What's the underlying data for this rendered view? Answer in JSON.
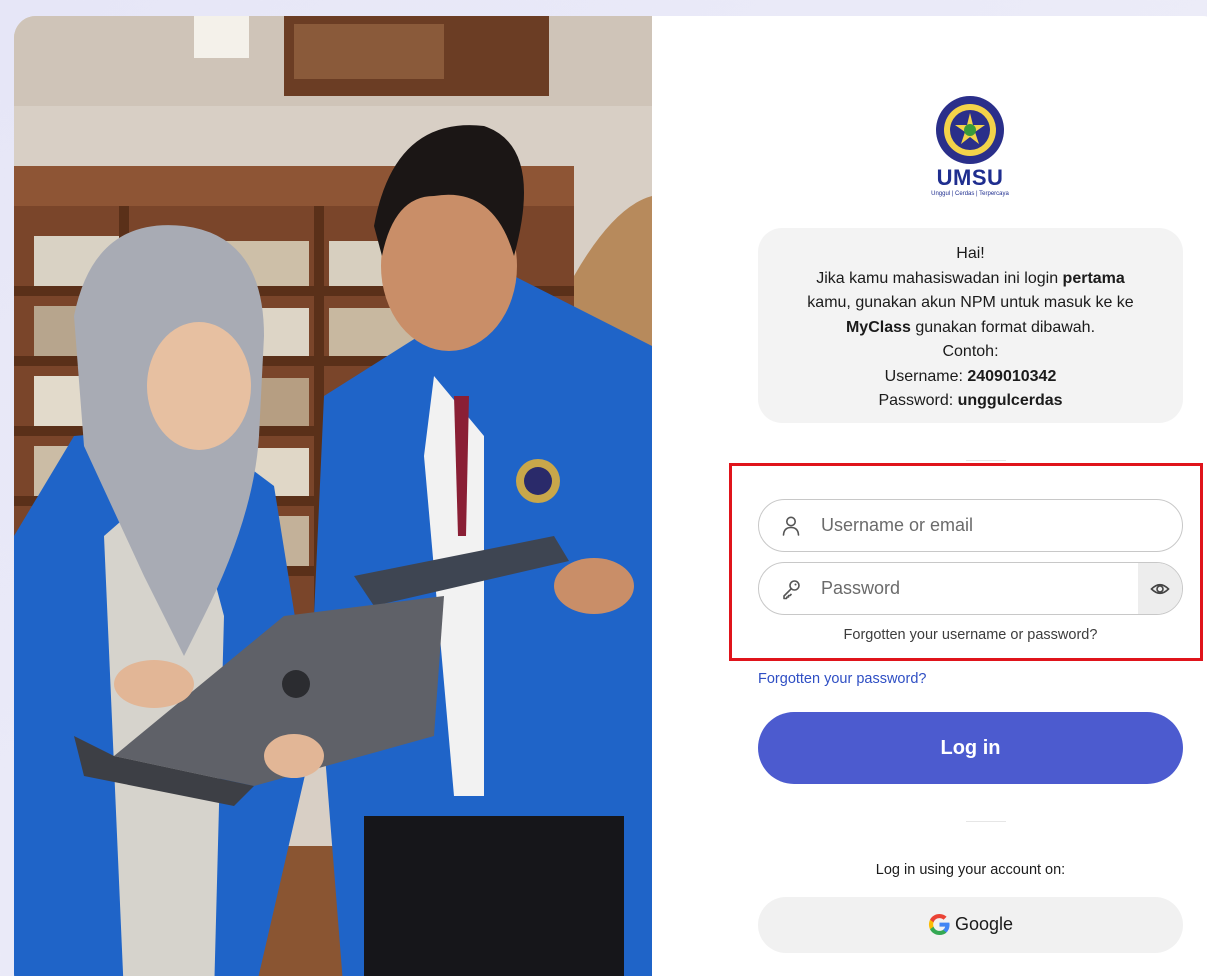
{
  "brand": {
    "logo_text": "UMSU",
    "logo_tagline": "Unggul | Cerdas | Terpercaya",
    "primary_color": "#4c5bcf",
    "logo_color": "#1f2e8f"
  },
  "info": {
    "greeting": "Hai!",
    "line1_pre": "Jika kamu mahasiswadan ini login ",
    "line1_bold": "pertama",
    "line2": "kamu, gunakan akun NPM untuk masuk ke ke",
    "line3_bold": "MyClass",
    "line3_post": " gunakan format dibawah.",
    "example_label": "Contoh:",
    "username_label": "Username: ",
    "username_value": "2409010342",
    "password_label": "Password: ",
    "password_value": "unggulcerdas"
  },
  "form": {
    "username_placeholder": "Username or email",
    "password_placeholder": "Password",
    "forgotten_inline": "Forgotten your username or password?",
    "forgotten_link": "Forgotten your password?",
    "login_label": "Log in",
    "highlight_color": "#e0141b"
  },
  "sso": {
    "heading": "Log in using your account on:",
    "google_label": "Google"
  },
  "icons": [
    "user-icon",
    "key-icon",
    "eye-icon",
    "google-icon",
    "umsu-seal-icon"
  ]
}
